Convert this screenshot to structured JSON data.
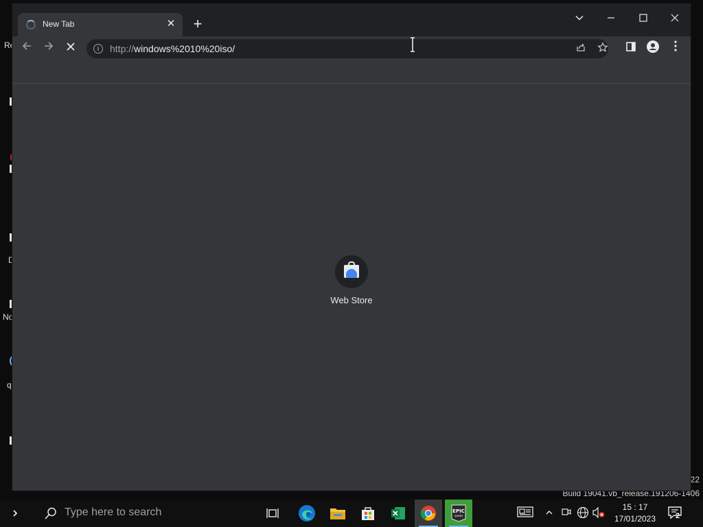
{
  "desktop": {
    "fragments": [
      "Re",
      "D",
      "No",
      "q"
    ],
    "watermark_line1": "22",
    "watermark_line2": "Build 19041.vb_release.191206-1406"
  },
  "browser": {
    "tab": {
      "title": "New Tab",
      "close_symbol": "✕"
    },
    "new_tab_symbol": "+",
    "window_controls": {
      "tab_search": "tab-search",
      "minimize": "minimize",
      "maximize": "maximize",
      "close": "close"
    },
    "toolbar": {
      "url_scheme": "http://",
      "url_rest": "windows%2010%20iso/",
      "info_symbol": "i"
    },
    "shortcut": {
      "label": "Web Store"
    }
  },
  "taskbar": {
    "search_placeholder": "Type here to search",
    "time": "15 : 17",
    "date": "17/01/2023",
    "notification_count": "2",
    "pinned": [
      "task-view",
      "edge",
      "file-explorer",
      "microsoft-store",
      "excel",
      "chrome",
      "epic-games"
    ],
    "epic_label_top": "EPIC",
    "epic_label_bottom": "GAMES"
  },
  "colors": {
    "window_bg": "#35363a",
    "tabstrip_bg": "#202124",
    "omnibox_bg": "#202124",
    "taskbar_bg": "#101010",
    "accent": "#8ab4f8"
  }
}
